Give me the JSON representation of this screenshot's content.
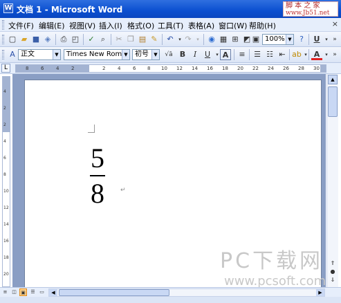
{
  "window": {
    "title": "文档 1 - Microsoft Word",
    "app_icon_letter": "W"
  },
  "watermark_top": {
    "line1": "脚 本 之 家",
    "line2": "www.Jb51.net"
  },
  "menu": {
    "items": [
      "文件(F)",
      "编辑(E)",
      "视图(V)",
      "插入(I)",
      "格式(O)",
      "工具(T)",
      "表格(A)",
      "窗口(W)",
      "帮助(H)"
    ],
    "more": "×"
  },
  "toolbar_standard": {
    "zoom": "100%",
    "underline_glyph": "U"
  },
  "toolbar_formatting": {
    "style": "正文",
    "font": "Times New Roma",
    "size": "初号",
    "bold": "B",
    "italic": "I",
    "underline": "U",
    "sqrt": "√ā",
    "highlight_color": "#f6e21a",
    "font_color": "#e02020"
  },
  "ruler": {
    "labels": [
      "8",
      "6",
      "4",
      "2",
      "2",
      "4",
      "6",
      "8",
      "10",
      "12",
      "14",
      "16",
      "18",
      "20",
      "22",
      "24",
      "26",
      "28",
      "30"
    ]
  },
  "vruler": {
    "labels": [
      "4",
      "2",
      "2",
      "4",
      "6",
      "8",
      "10",
      "12",
      "14",
      "16",
      "18",
      "20"
    ]
  },
  "document": {
    "numerator": "5",
    "denominator": "8",
    "para_mark": "↵"
  },
  "watermark_bottom": {
    "big": "PC下载网",
    "url": "www.pcsoft.com.cn"
  }
}
